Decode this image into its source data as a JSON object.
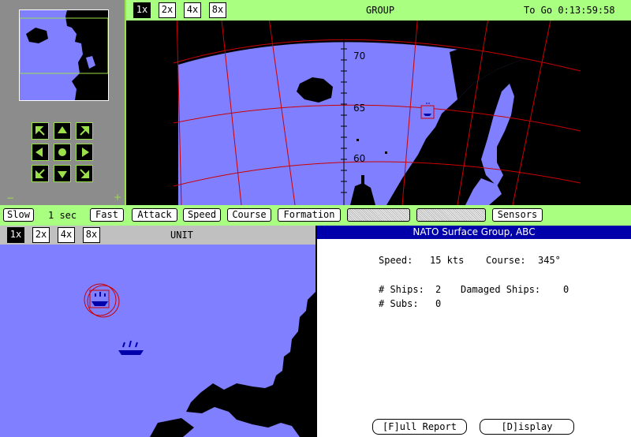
{
  "top_bar": {
    "zoom_buttons": [
      "1x",
      "2x",
      "4x",
      "8x"
    ],
    "title": "GROUP",
    "to_go": "To Go 0:13:59:58"
  },
  "nav_panel": {
    "minus": "−",
    "plus": "+"
  },
  "map": {
    "lat_labels": [
      "70",
      "65",
      "60"
    ]
  },
  "command_bar": {
    "slow": "Slow",
    "time": "1 sec",
    "fast": "Fast",
    "attack": "Attack",
    "speed": "Speed",
    "course": "Course",
    "formation": "Formation",
    "sensors": "Sensors"
  },
  "unit_bar": {
    "zoom_buttons": [
      "1x",
      "2x",
      "4x",
      "8x"
    ],
    "title": "UNIT"
  },
  "info_panel": {
    "title": "NATO Surface Group, ABC",
    "speed_label": "Speed:",
    "speed_value": "15 kts",
    "course_label": "Course:",
    "course_value": "345°",
    "ships_label": "# Ships:",
    "ships_value": "2",
    "damaged_label": "Damaged Ships:",
    "damaged_value": "0",
    "subs_label": "# Subs:",
    "subs_value": "0",
    "full_report": "[F]ull Report",
    "display": "[D]isplay"
  },
  "colors": {
    "sea": "#7f7fff",
    "land": "#000000",
    "grid": "#cc0000",
    "bar_green": "#a8ff80",
    "panel_gray": "#8c8c8c",
    "header_blue": "#0000aa"
  }
}
